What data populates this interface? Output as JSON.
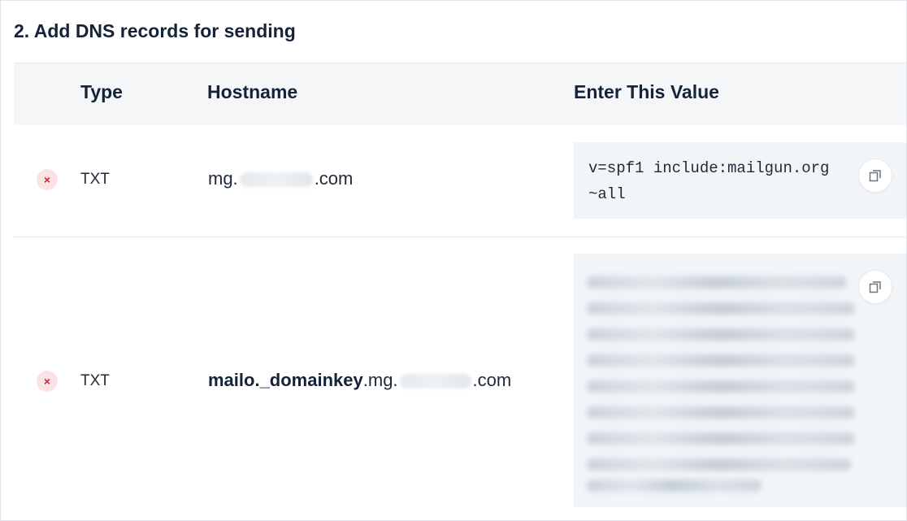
{
  "section": {
    "title": "2. Add DNS records for sending"
  },
  "table": {
    "headers": {
      "type": "Type",
      "hostname": "Hostname",
      "value": "Enter This Value"
    },
    "rows": [
      {
        "status_icon": "error-x-icon",
        "status_glyph": "×",
        "type": "TXT",
        "host_prefix": "mg.",
        "host_suffix": ".com",
        "value": "v=spf1 include:mailgun.org\n~all"
      },
      {
        "status_icon": "error-x-icon",
        "status_glyph": "×",
        "type": "TXT",
        "host_bold": "mailo._domainkey",
        "host_prefix": ".mg.",
        "host_suffix": ".com"
      }
    ]
  },
  "icons": {
    "copy": "copy-icon"
  },
  "colors": {
    "error": "#c0283a",
    "error_bg": "#fbe3e5",
    "header_bg": "#f4f6f8",
    "value_bg": "#f1f5f8"
  }
}
